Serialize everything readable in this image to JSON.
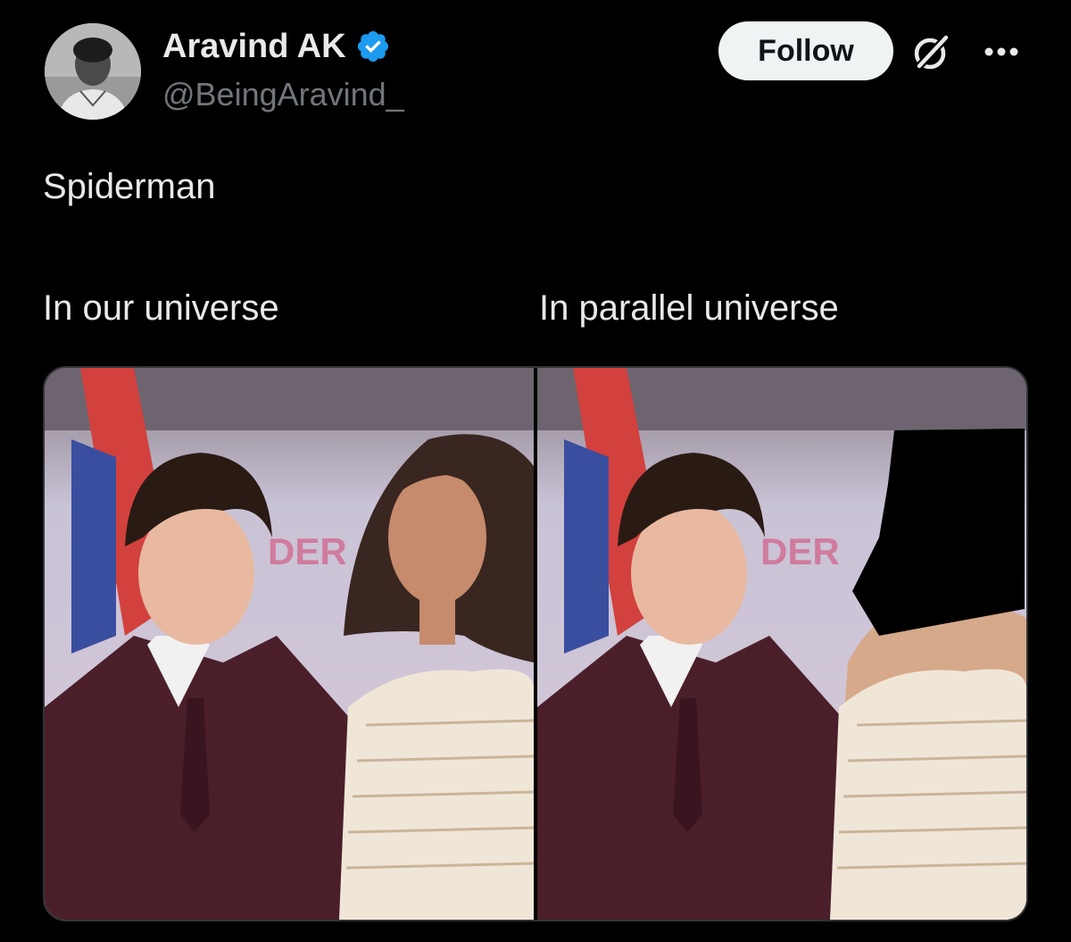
{
  "author": {
    "display_name": "Aravind AK",
    "handle": "@BeingAravind_",
    "verified": true,
    "avatar_icon": "user-avatar"
  },
  "actions": {
    "follow_label": "Follow",
    "grok_icon": "grok-icon",
    "more_icon": "more-options-icon"
  },
  "tweet": {
    "line1": "Spiderman",
    "caption_left": "In our universe",
    "caption_right": "In parallel universe"
  },
  "media": {
    "left_panel": "photo-original",
    "right_panel": "photo-edited"
  },
  "colors": {
    "background": "#000000",
    "text": "#e7e9ea",
    "secondary_text": "#71767b",
    "verified": "#1d9bf0",
    "button_bg": "#eff3f4",
    "button_text": "#0f1419"
  }
}
